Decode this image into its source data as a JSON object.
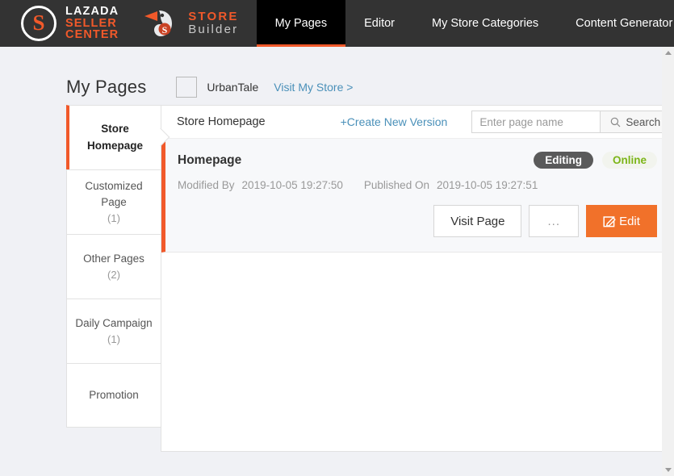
{
  "header": {
    "logo": {
      "lazada_line1": "LAZADA",
      "lazada_line2": "SELLER",
      "lazada_line3": "CENTER",
      "mark_letter": "S",
      "store_word": "STORE",
      "builder_word": "Builder",
      "sb_mark_letter": "S"
    },
    "nav": [
      {
        "label": "My Pages",
        "active": true
      },
      {
        "label": "Editor",
        "active": false
      },
      {
        "label": "My Store Categories",
        "active": false
      },
      {
        "label": "Content Generator",
        "active": false
      }
    ]
  },
  "page": {
    "title": "My Pages",
    "store_name": "UrbanTale",
    "store_link": "Visit My Store >"
  },
  "sidebar": {
    "items": [
      {
        "label": "Store Homepage",
        "count": "",
        "active": true
      },
      {
        "label": "Customized Page",
        "count": "(1)",
        "active": false
      },
      {
        "label": "Other Pages",
        "count": "(2)",
        "active": false
      },
      {
        "label": "Daily Campaign",
        "count": "(1)",
        "active": false
      },
      {
        "label": "Promotion",
        "count": "",
        "active": false
      }
    ]
  },
  "panel": {
    "heading": "Store Homepage",
    "create_link": "+Create New Version",
    "search": {
      "placeholder": "Enter page name",
      "value": "",
      "button_label": "Search",
      "icon": "search-icon"
    }
  },
  "card": {
    "title": "Homepage",
    "badge_editing": "Editing",
    "badge_online": "Online",
    "modified_label": "Modified By",
    "modified_value": "2019-10-05 19:27:50",
    "published_label": "Published On",
    "published_value": "2019-10-05 19:27:51",
    "actions": {
      "visit_label": "Visit Page",
      "more_label": "...",
      "edit_label": "Edit",
      "edit_icon": "pencil-square-icon"
    }
  },
  "colors": {
    "accent_orange": "#f1592a",
    "edit_orange": "#f1712a",
    "header_dark": "#333333",
    "active_tab": "#000000",
    "link_blue": "#4a90b9",
    "online_green": "#7cb518",
    "editing_gray": "#5a5a5a",
    "page_bg": "#f0f1f5"
  }
}
